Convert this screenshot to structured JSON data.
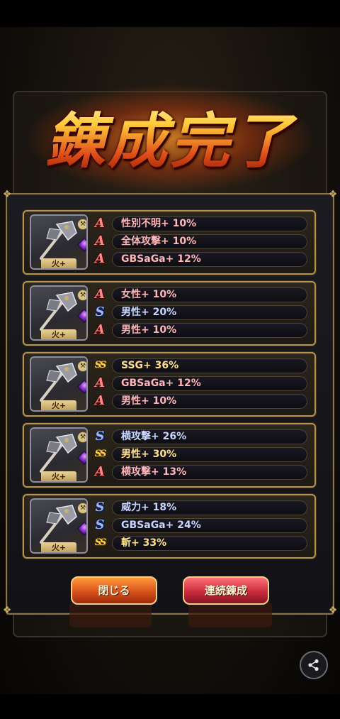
{
  "title": "錬成完了",
  "results": [
    {
      "element": "火+",
      "stats": [
        {
          "rank": "A",
          "rank_label": "A",
          "text": "性別不明+ 10%"
        },
        {
          "rank": "A",
          "rank_label": "A",
          "text": "全体攻撃+ 10%"
        },
        {
          "rank": "A",
          "rank_label": "A",
          "text": "GBSaGa+ 12%"
        }
      ]
    },
    {
      "element": "火+",
      "stats": [
        {
          "rank": "A",
          "rank_label": "A",
          "text": "女性+ 10%"
        },
        {
          "rank": "S",
          "rank_label": "S",
          "text": "男性+ 20%"
        },
        {
          "rank": "A",
          "rank_label": "A",
          "text": "男性+ 10%"
        }
      ]
    },
    {
      "element": "火+",
      "stats": [
        {
          "rank": "SS",
          "rank_label": "SS",
          "text": "SSG+ 36%"
        },
        {
          "rank": "A",
          "rank_label": "A",
          "text": "GBSaGa+ 12%"
        },
        {
          "rank": "A",
          "rank_label": "A",
          "text": "男性+ 10%"
        }
      ]
    },
    {
      "element": "火+",
      "stats": [
        {
          "rank": "S",
          "rank_label": "S",
          "text": "横攻撃+ 26%"
        },
        {
          "rank": "SS",
          "rank_label": "SS",
          "text": "男性+ 30%"
        },
        {
          "rank": "A",
          "rank_label": "A",
          "text": "横攻撃+ 13%"
        }
      ]
    },
    {
      "element": "火+",
      "stats": [
        {
          "rank": "S",
          "rank_label": "S",
          "text": "威力+ 18%"
        },
        {
          "rank": "S",
          "rank_label": "S",
          "text": "GBSaGa+ 24%"
        },
        {
          "rank": "SS",
          "rank_label": "SS",
          "text": "斬+ 33%"
        }
      ]
    }
  ],
  "buttons": {
    "close": "閉じる",
    "continue": "連続錬成"
  },
  "icons": {
    "weapon": "axe-icon",
    "weapon_type": "axe-type-badge-icon",
    "gem": "purple-gem-icon",
    "share": "share-icon"
  },
  "colors": {
    "rank_A": "#ff8888",
    "rank_S": "#9ab8ff",
    "rank_SS": "#ffd24a",
    "close_button": "#d8521c",
    "continue_button": "#c92c3e"
  }
}
